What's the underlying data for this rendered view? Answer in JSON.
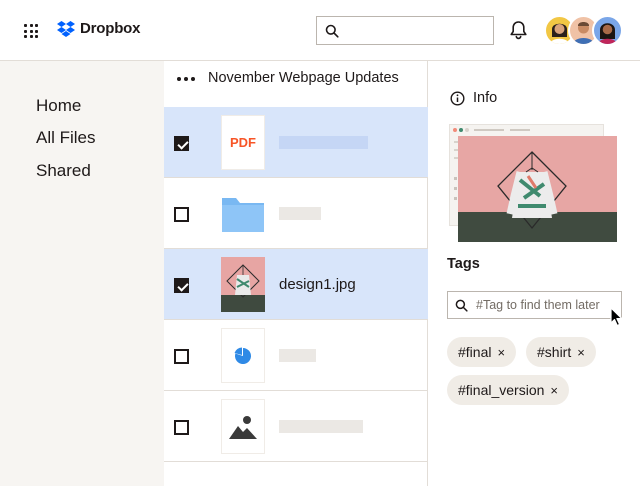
{
  "app": {
    "brand": "Dropbox",
    "colors": {
      "accent": "#0061fe",
      "selected_row": "#d8e5fa",
      "sidebar_bg": "#f7f5f2",
      "pdf": "#f75527"
    }
  },
  "header": {
    "search": {
      "placeholder": "",
      "value": ""
    },
    "avatars": [
      "avatar-1",
      "avatar-2",
      "avatar-3"
    ]
  },
  "sidebar": {
    "items": [
      {
        "label": "Home"
      },
      {
        "label": "All Files"
      },
      {
        "label": "Shared"
      }
    ]
  },
  "main": {
    "folder_title": "November Webpage Updates",
    "rows": [
      {
        "checked": true,
        "thumb": "pdf",
        "thumb_label": "PDF",
        "name": ""
      },
      {
        "checked": false,
        "thumb": "folder-icon",
        "name": ""
      },
      {
        "checked": true,
        "thumb": "image-preview",
        "name": "design1.jpg"
      },
      {
        "checked": false,
        "thumb": "pie-chart-icon",
        "name": ""
      },
      {
        "checked": false,
        "thumb": "image-icon",
        "name": ""
      }
    ]
  },
  "info_panel": {
    "title": "Info",
    "tags_title": "Tags",
    "tag_input": {
      "placeholder": "#Tag to find them later",
      "value": ""
    },
    "tags": [
      {
        "label": "#final",
        "remove": "×"
      },
      {
        "label": "#shirt",
        "remove": "×"
      },
      {
        "label": "#final_version",
        "remove": "×"
      }
    ]
  }
}
